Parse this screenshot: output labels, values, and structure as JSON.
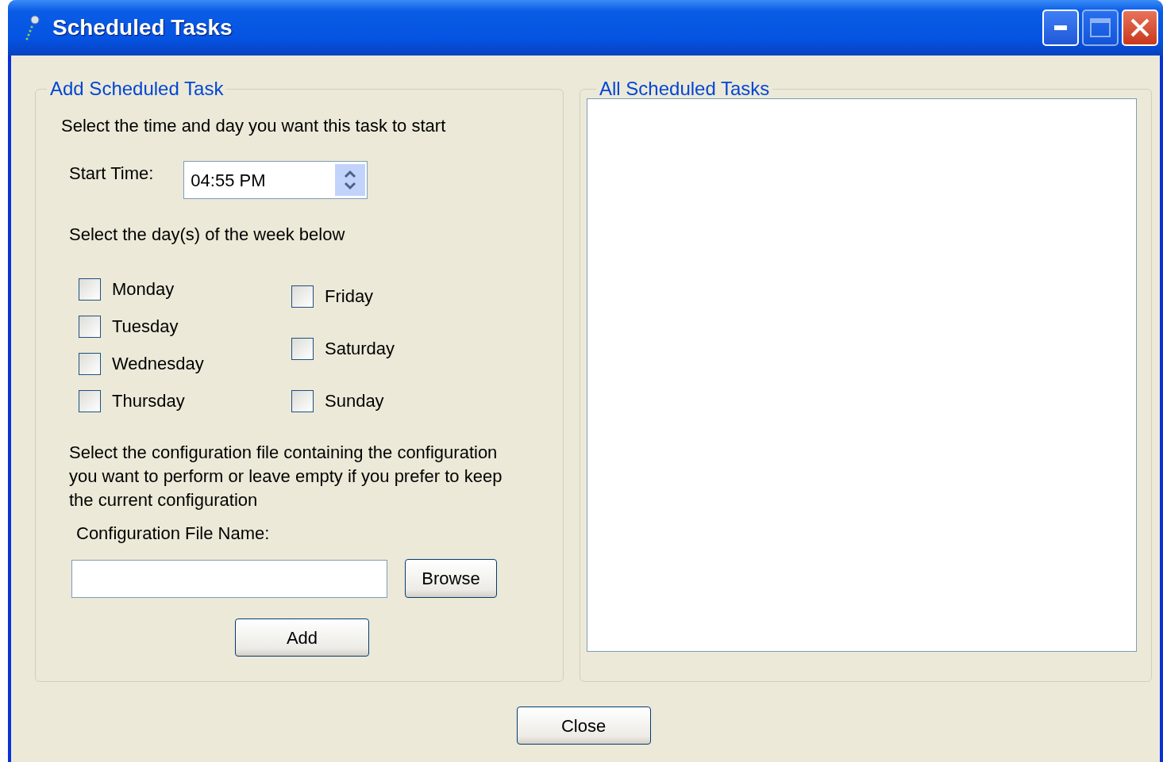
{
  "window": {
    "title": "Scheduled Tasks"
  },
  "add_panel": {
    "title": "Add Scheduled Task",
    "intro": "Select the time and day you want this task to start",
    "start_time": {
      "label": "Start Time:",
      "value": "04:55 PM"
    },
    "days_prompt": "Select the day(s) of the week below",
    "day_columns": [
      [
        {
          "label": "Monday",
          "checked": false
        },
        {
          "label": "Tuesday",
          "checked": false
        },
        {
          "label": "Wednesday",
          "checked": false
        },
        {
          "label": "Thursday",
          "checked": false
        }
      ],
      [
        {
          "label": "Friday",
          "checked": false
        },
        {
          "label": "Saturday",
          "checked": false
        },
        {
          "label": "Sunday",
          "checked": false
        }
      ]
    ],
    "config_prompt": "Select the configuration file containing the configuration you want to perform or leave empty if you prefer to keep the current configuration",
    "config_label": "Configuration File Name:",
    "browse_button": "Browse",
    "add_button": "Add"
  },
  "tasks_panel": {
    "title": "All Scheduled Tasks"
  },
  "close_button": "Close"
}
